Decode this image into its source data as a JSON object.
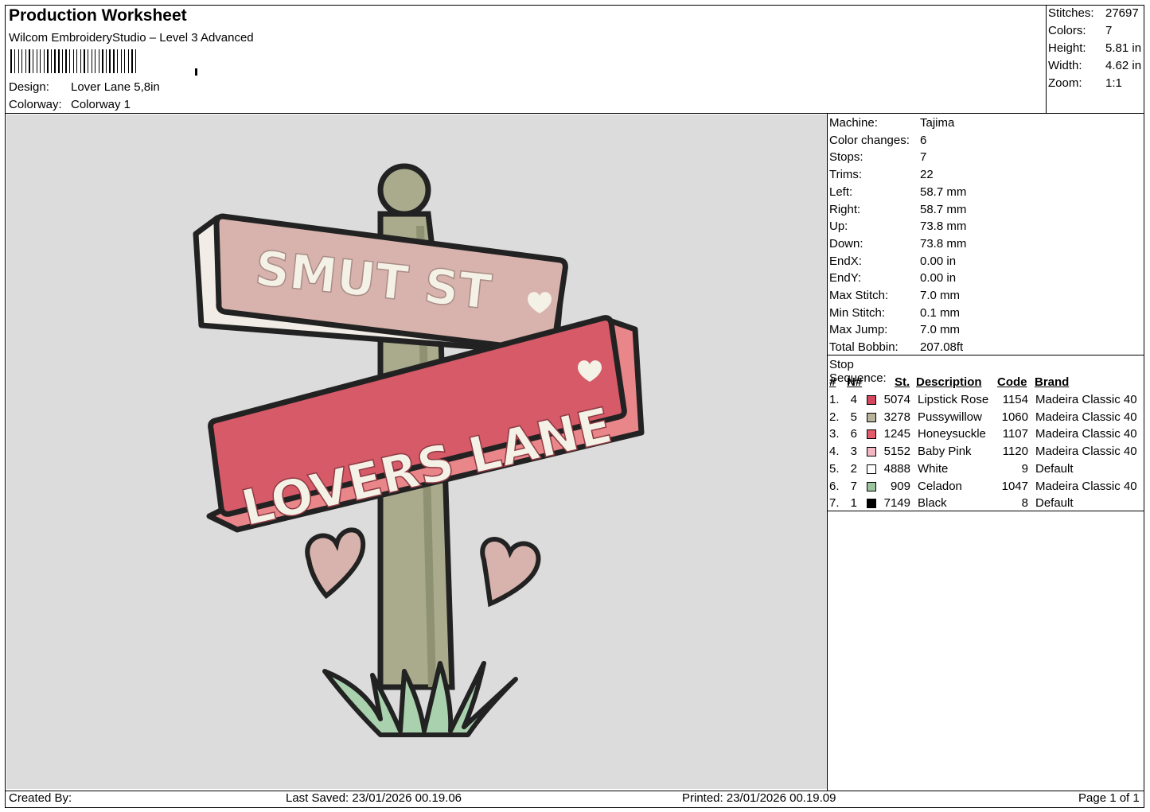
{
  "header": {
    "title": "Production Worksheet",
    "software": "Wilcom EmbroideryStudio – Level 3 Advanced",
    "design_label": "Design:",
    "design_value": "Lover Lane 5,8in",
    "colorway_label": "Colorway:",
    "colorway_value": "Colorway 1"
  },
  "summary": {
    "stitches_label": "Stitches:",
    "stitches": "27697",
    "colors_label": "Colors:",
    "colors": "7",
    "height_label": "Height:",
    "height": "5.81 in",
    "width_label": "Width:",
    "width": "4.62 in",
    "zoom_label": "Zoom:",
    "zoom": "1:1"
  },
  "machine": {
    "machine_label": "Machine:",
    "machine": "Tajima",
    "color_changes_label": "Color changes:",
    "color_changes": "6",
    "stops_label": "Stops:",
    "stops": "7",
    "trims_label": "Trims:",
    "trims": "22",
    "left_label": "Left:",
    "left": "58.7 mm",
    "right_label": "Right:",
    "right": "58.7 mm",
    "up_label": "Up:",
    "up": "73.8 mm",
    "down_label": "Down:",
    "down": "73.8 mm",
    "endx_label": "EndX:",
    "endx": "0.00 in",
    "endy_label": "EndY:",
    "endy": "0.00 in",
    "max_stitch_label": "Max Stitch:",
    "max_stitch": "7.0 mm",
    "min_stitch_label": "Min Stitch:",
    "min_stitch": "0.1 mm",
    "max_jump_label": "Max Jump:",
    "max_jump": "7.0 mm",
    "bobbin_label": "Total Bobbin:",
    "bobbin": "207.08ft"
  },
  "stop_sequence": {
    "heading": "Stop Sequence:",
    "columns": {
      "num": "#",
      "n": "N#",
      "st": "St.",
      "description": "Description",
      "code": "Code",
      "brand": "Brand"
    },
    "rows": [
      {
        "num": "1.",
        "n": "4",
        "color": "#d6475e",
        "st": "5074",
        "description": "Lipstick Rose",
        "code": "1154",
        "brand": "Madeira Classic 40"
      },
      {
        "num": "2.",
        "n": "5",
        "color": "#b8b49c",
        "st": "3278",
        "description": "Pussywillow",
        "code": "1060",
        "brand": "Madeira Classic 40"
      },
      {
        "num": "3.",
        "n": "6",
        "color": "#e35b6c",
        "st": "1245",
        "description": "Honeysuckle",
        "code": "1107",
        "brand": "Madeira Classic 40"
      },
      {
        "num": "4.",
        "n": "3",
        "color": "#f3b6c2",
        "st": "5152",
        "description": "Baby Pink",
        "code": "1120",
        "brand": "Madeira Classic 40"
      },
      {
        "num": "5.",
        "n": "2",
        "color": "#ffffff",
        "st": "4888",
        "description": "White",
        "code": "9",
        "brand": "Default"
      },
      {
        "num": "6.",
        "n": "7",
        "color": "#9cc29e",
        "st": "909",
        "description": "Celadon",
        "code": "1047",
        "brand": "Madeira Classic 40"
      },
      {
        "num": "7.",
        "n": "1",
        "color": "#000000",
        "st": "7149",
        "description": "Black",
        "code": "8",
        "brand": "Default"
      }
    ]
  },
  "artwork": {
    "sign_top_text": "SMUT ST",
    "sign_bottom_text": "LOVERS LANE"
  },
  "footer": {
    "created_by": "Created By:",
    "last_saved": "Last Saved: 23/01/2026 00.19.06",
    "printed": "Printed: 23/01/2026 00.19.09",
    "page": "Page 1 of 1"
  }
}
